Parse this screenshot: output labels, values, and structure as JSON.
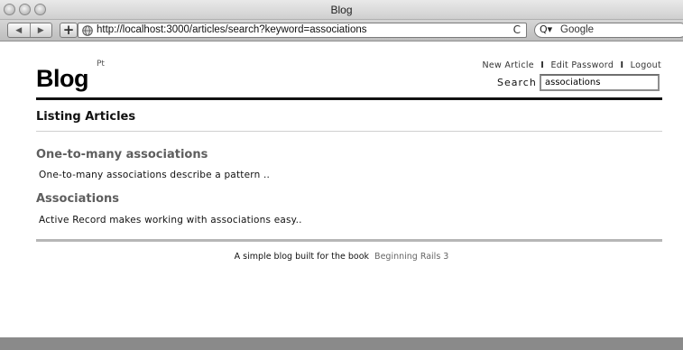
{
  "window": {
    "title": "Blog"
  },
  "toolbar": {
    "back": "◀",
    "forward": "▶",
    "add": "+",
    "url": "http://localhost:3000/articles/search?keyword=associations",
    "reload": "C",
    "search_placeholder": "Google",
    "search_icon": "Q▾"
  },
  "header": {
    "brand": "Blog",
    "brand_sup": "Pt",
    "nav": {
      "new_article": "New Article",
      "edit_password": "Edit Password",
      "logout": "Logout",
      "separator": "I"
    },
    "search": {
      "label": "Search",
      "value": "associations"
    }
  },
  "main": {
    "heading": "Listing Articles",
    "articles": [
      {
        "title": "One-to-many associations",
        "excerpt": "One-to-many associations describe a pattern .."
      },
      {
        "title": "Associations",
        "excerpt": "Active Record makes working with associations easy.."
      }
    ]
  },
  "footer": {
    "text": "A simple blog built for the book",
    "link": "Beginning Rails 3"
  },
  "colors": {
    "title_grey": "#5e5e5e",
    "rule_dark": "#111111",
    "rule_grey": "#b6b6b6"
  }
}
